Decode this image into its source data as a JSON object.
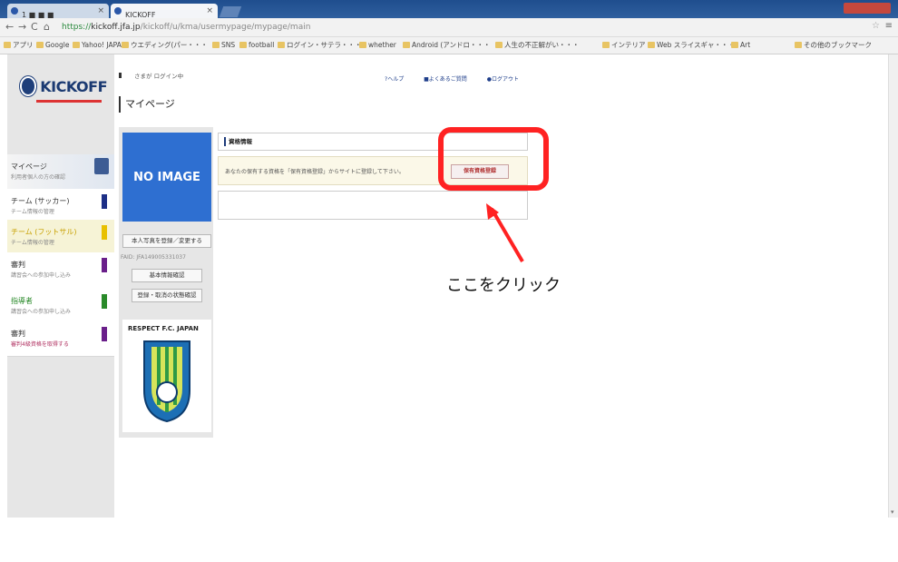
{
  "browser": {
    "tabs": [
      {
        "label": "1 ■ ■ ■"
      },
      {
        "label": "KICKOFF"
      }
    ],
    "url": {
      "scheme": "https://",
      "host": "kickoff.jfa.jp",
      "path": "/kickoff/u/kma/usermypage/mypage/main"
    },
    "bookmarks": [
      "アプリ",
      "Google",
      "Yahoo! JAPAN",
      "ウエディング(パー・・・",
      "SNS",
      "football",
      "ログイン・サテラ・・・",
      "whether",
      "Android (アンドロ・・・",
      "人生の不正解がい・・・",
      "インテリア",
      "Web スライスギャ・・・",
      "Art",
      "その他のブックマーク"
    ]
  },
  "header": {
    "login_status": "さまが ログイン中",
    "links": [
      "ヘルプ",
      "よくあるご質問",
      "ログアウト"
    ]
  },
  "logo": {
    "text": "KICKOFF"
  },
  "sidebar": {
    "items": [
      {
        "label": "マイページ",
        "sub": "利用者個人の方の確認",
        "active": true,
        "color": "#3d5c94"
      },
      {
        "label": "チーム (サッカー)",
        "sub": "チーム情報の管理",
        "active": false,
        "color": "#1d2f86"
      },
      {
        "label": "チーム (フットサル)",
        "sub": "チーム情報の管理",
        "active": false,
        "color": "#e8c000"
      },
      {
        "label": "審判",
        "sub": "講習会への参加申し込み",
        "active": false,
        "color": "#6a1f8a"
      },
      {
        "label": "指導者",
        "sub": "講習会への参加申し込み",
        "active": false,
        "color": "#2a8a2a"
      },
      {
        "label": "審判",
        "sub": "審判4級資格を取得する",
        "active": false,
        "color": "#6a1f8a"
      }
    ]
  },
  "page": {
    "title": "マイページ",
    "profile": {
      "no_image": "NO IMAGE",
      "photo_button": "本人写真を登録／変更する",
      "fid": "FAID: JFA149005331037",
      "basic_info_button": "基本情報確認",
      "history_button": "登録・取消の状態確認",
      "emblem_title": "RESPECT F.C. JAPAN"
    },
    "qualification": {
      "title": "資格情報",
      "notice": "あなたの保有する資格を「保有資格登録」からサイトに登録して下さい。",
      "register_button": "保有資格登録"
    },
    "annotation": "ここをクリック"
  },
  "colors": {
    "highlight": "#ff2222",
    "no_image_bg": "#2e6fd1"
  }
}
